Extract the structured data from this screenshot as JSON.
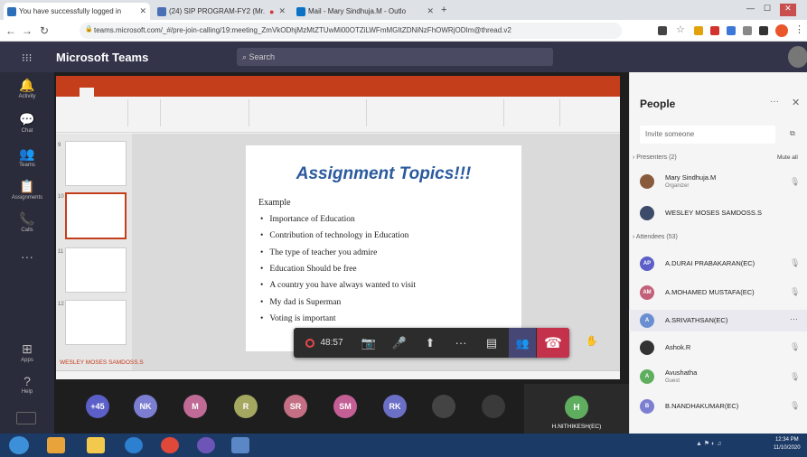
{
  "browser": {
    "tabs": [
      {
        "title": "You have successfully logged in",
        "color": "#2d6fb8"
      },
      {
        "title": "(24) SIP PROGRAM-FY2 (Mr.",
        "color": "#4a6fb5"
      },
      {
        "title": "Mail - Mary Sindhuja.M - Outlo",
        "color": "#0b72c4"
      }
    ],
    "url": "teams.microsoft.com/_#/pre-join-calling/19:meeting_ZmVkODhjMzMtZTUwMi00OTZiLWFmMGItZDNiNzFhOWRjODIm@thread.v2"
  },
  "teams": {
    "title": "Microsoft Teams",
    "search_placeholder": "Search",
    "rail": [
      {
        "icon": "bell-icon",
        "label": "Activity",
        "glyph": "🔔"
      },
      {
        "icon": "chat-icon",
        "label": "Chat",
        "glyph": "💬"
      },
      {
        "icon": "teams-icon",
        "label": "Teams",
        "glyph": "👥"
      },
      {
        "icon": "assignments-icon",
        "label": "Assignments",
        "glyph": "📋"
      },
      {
        "icon": "calls-icon",
        "label": "Calls",
        "glyph": "📞"
      },
      {
        "icon": "more-icon",
        "label": "",
        "glyph": "···"
      },
      {
        "icon": "apps-icon",
        "label": "Apps",
        "glyph": "⊞"
      },
      {
        "icon": "help-icon",
        "label": "Help",
        "glyph": "?"
      }
    ]
  },
  "slide": {
    "title": "Assignment Topics!!!",
    "example_label": "Example",
    "bullets": [
      "Importance of Education",
      "Contribution of technology in Education",
      "The type of teacher you admire",
      "Education Should be free",
      "A country you have always wanted to visit",
      "My dad is Superman",
      "Voting is important"
    ]
  },
  "call": {
    "timer": "48:57"
  },
  "gallery": [
    {
      "initials": "+45",
      "color": "#5b5fc7"
    },
    {
      "initials": "NK",
      "color": "#7c7fd1"
    },
    {
      "initials": "M",
      "color": "#c06a96"
    },
    {
      "initials": "R",
      "color": "#a3a760"
    },
    {
      "initials": "SR",
      "color": "#c46f84"
    },
    {
      "initials": "SM",
      "color": "#c45f96"
    },
    {
      "initials": "RK",
      "color": "#6b6fc6"
    },
    {
      "initials": "",
      "color": "#444444"
    },
    {
      "initials": "",
      "color": "#3a3a3a"
    }
  ],
  "active_tile": {
    "initials": "H",
    "name": "H.NITHIKESH(EC)"
  },
  "people": {
    "title": "People",
    "invite_placeholder": "Invite someone",
    "presenters_label": "Presenters (2)",
    "mute_all": "Mute all",
    "presenters": [
      {
        "name": "Mary Sindhuja.M",
        "role": "Organizer",
        "initials": "",
        "color": "#8a5a3c"
      },
      {
        "name": "WESLEY MOSES SAMDOSS.S",
        "role": "",
        "initials": "",
        "color": "#3c4b6a"
      }
    ],
    "attendees_label": "Attendees (53)",
    "attendees": [
      {
        "name": "A.DURAI PRABAKARAN(EC)",
        "role": "",
        "initials": "AP",
        "color": "#5b5fc7"
      },
      {
        "name": "A.MOHAMED MUSTAFA(EC)",
        "role": "",
        "initials": "AM",
        "color": "#c45f7a"
      },
      {
        "name": "A.SRIVATHSAN(EC)",
        "role": "",
        "initials": "A",
        "color": "#6a8fd1"
      },
      {
        "name": "Ashok.R",
        "role": "",
        "initials": "",
        "color": "#333333"
      },
      {
        "name": "Avushatha",
        "role": "Guest",
        "initials": "A",
        "color": "#5fae5f"
      },
      {
        "name": "B.NANDHAKUMAR(EC)",
        "role": "",
        "initials": "B",
        "color": "#7c7fd1"
      }
    ]
  },
  "taskbar": {
    "time": "12:34 PM",
    "date": "11/10/2020"
  },
  "watermark": "WESLEY MOSES SAMDOSS.S"
}
